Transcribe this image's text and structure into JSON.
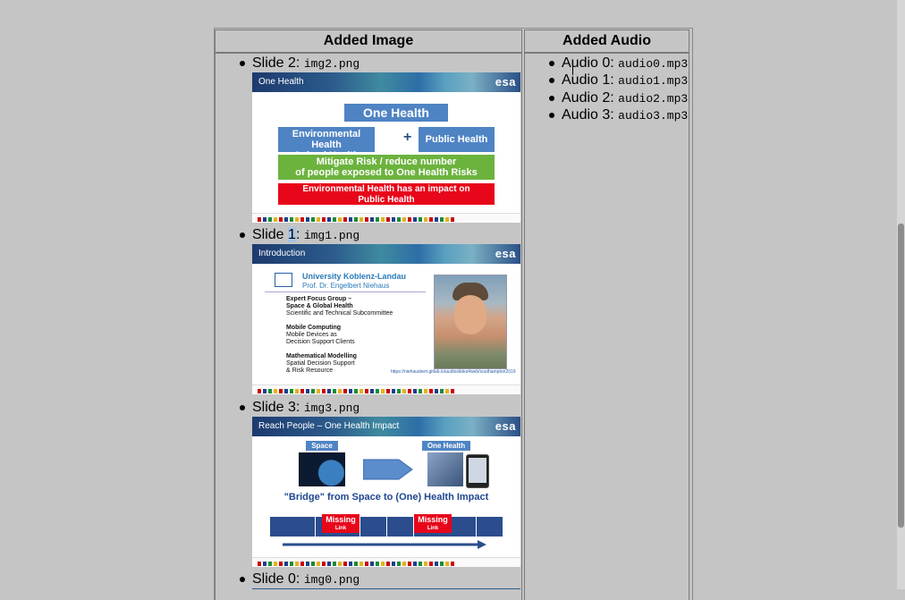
{
  "table": {
    "image_header": "Added Image",
    "audio_header": "Added Audio"
  },
  "slides": [
    {
      "label": "Slide 2: ",
      "file": "img2.png",
      "banner": "One Health"
    },
    {
      "label_pre": "Slide ",
      "label_hl": "1",
      "label_post": ": ",
      "file": "img1.png",
      "banner": "Introduction"
    },
    {
      "label": "Slide 3: ",
      "file": "img3.png",
      "banner": "Reach People – One Health Impact"
    },
    {
      "label": "Slide 0: ",
      "file": "img0.png"
    }
  ],
  "slide2": {
    "top": "One Health",
    "left": "Environmental Health\nAnimal Health",
    "plus": "+",
    "right": "Public Health",
    "green": "Mitigate Risk / reduce number\nof people exposed to One Health Risks",
    "red": "Environmental Health has an impact on\nPublic Health"
  },
  "slide1": {
    "uni": "University Koblenz-Landau",
    "prof": "Prof. Dr. Engelbert Niehaus",
    "g1_title": "Expert Focus Group –\nSpace & Global Health",
    "g1_text": "Scientific and Technical Subcommittee",
    "g2_title": "Mobile Computing",
    "g2_text": "Mobile Devices as\nDecision Support Clients",
    "g3_title": "Mathematical Modelling",
    "g3_text": "Spatial Decision Support\n& Risk Resource",
    "url": "https://niehausbert.gitlab.io/audioslides4web/southampton2019"
  },
  "slide3": {
    "space": "Space",
    "onehealth": "One Health",
    "bridge": "\"Bridge\" from Space to (One) Health Impact",
    "missing": "Missing",
    "link": "Link"
  },
  "esa_logo": "esa",
  "audio": [
    {
      "label": "Audio 0: ",
      "file": "audio0.mp3"
    },
    {
      "label": "Audio 1: ",
      "file": "audio1.mp3"
    },
    {
      "label": "Audio 2: ",
      "file": "audio2.mp3"
    },
    {
      "label": "Audio 3: ",
      "file": "audio3.mp3"
    }
  ]
}
